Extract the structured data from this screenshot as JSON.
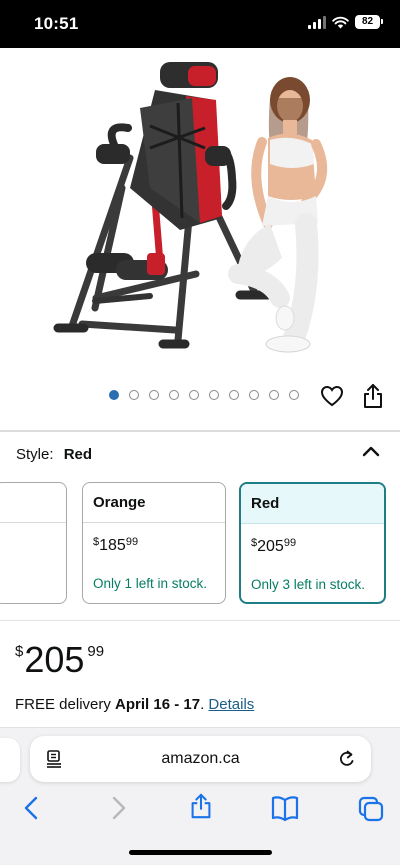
{
  "status_bar": {
    "time": "10:51",
    "battery": "82"
  },
  "product": {
    "image_alt": "Inversion table (red and black) with model"
  },
  "carousel": {
    "dot_count": 10,
    "active_index": 0
  },
  "style_selector": {
    "label": "Style:",
    "selected": "Red"
  },
  "swatches": [
    {
      "name": "",
      "currency": "",
      "price_whole": "",
      "price_cents": "",
      "stock": "",
      "selected": false
    },
    {
      "name": "Orange",
      "currency": "$",
      "price_whole": "185",
      "price_cents": "99",
      "stock": "Only 1 left in stock.",
      "selected": false
    },
    {
      "name": "Red",
      "currency": "$",
      "price_whole": "205",
      "price_cents": "99",
      "stock": "Only 3 left in stock.",
      "selected": true
    }
  ],
  "price": {
    "currency": "$",
    "whole": "205",
    "cents": "99"
  },
  "delivery": {
    "prefix": "FREE delivery ",
    "dates": "April 16 - 17",
    "suffix": ". ",
    "link": "Details"
  },
  "browser": {
    "url": "amazon.ca"
  },
  "icons": {
    "wishlist": "heart-icon",
    "share": "share-icon",
    "collapse": "chevron-up-icon",
    "page_menu": "page-format-icon",
    "reload": "reload-icon",
    "back": "back-arrow-icon",
    "forward": "forward-arrow-icon",
    "share_sheet": "share-icon",
    "bookmarks": "book-icon",
    "tabs": "tabs-icon"
  },
  "colors": {
    "accent_teal": "#1d7e86",
    "stock_green": "#067d62",
    "link_blue": "#1a5e8a",
    "dot_active": "#2a6fb0",
    "product_red": "#c8202a"
  }
}
